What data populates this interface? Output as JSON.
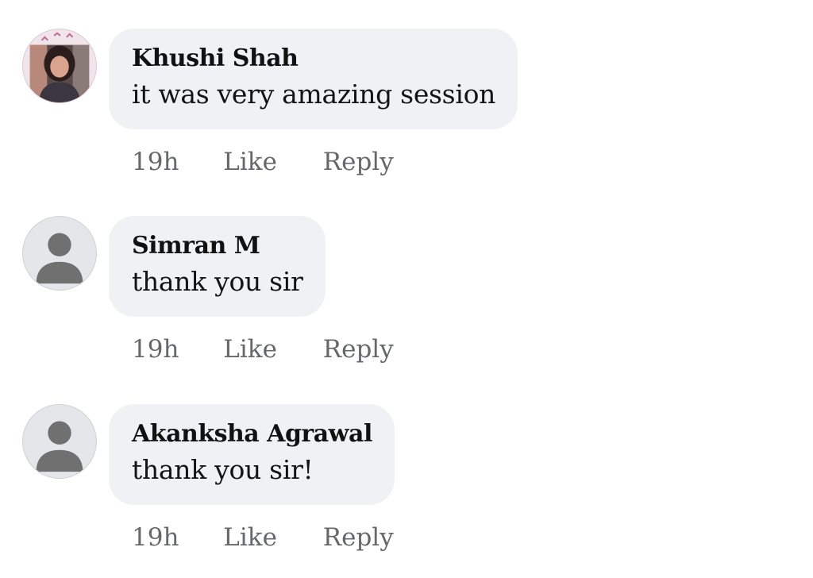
{
  "comments": [
    {
      "author": "Khushi Shah",
      "text": "it was very amazing session",
      "time": "19h",
      "like_label": "Like",
      "reply_label": "Reply",
      "avatar": "profile-photo"
    },
    {
      "author": "Simran M",
      "text": "thank you sir",
      "time": "19h",
      "like_label": "Like",
      "reply_label": "Reply",
      "avatar": "default-avatar-icon"
    },
    {
      "author": "Akanksha Agrawal",
      "text": "thank you sir!",
      "time": "19h",
      "like_label": "Like",
      "reply_label": "Reply",
      "avatar": "default-avatar-icon"
    }
  ],
  "colors": {
    "bubble_background": "#f0f1f4",
    "meta_text": "#65676b",
    "author_text": "#111111",
    "default_avatar_bg": "#e4e6ea",
    "default_avatar_figure": "#707070"
  }
}
